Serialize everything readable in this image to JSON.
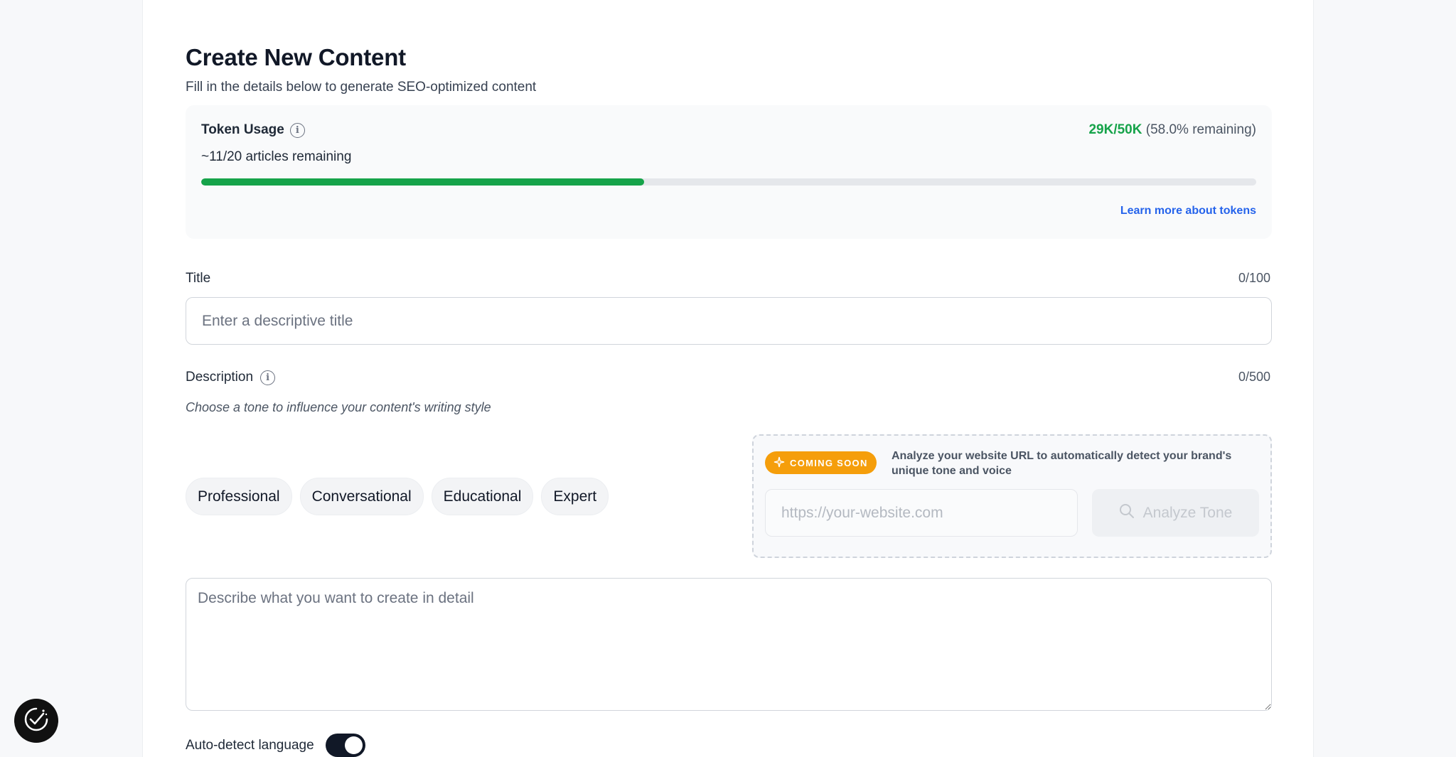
{
  "header": {
    "title": "Create New Content",
    "subtitle": "Fill in the details below to generate SEO-optimized content"
  },
  "token_usage": {
    "label": "Token Usage",
    "used": "29K/50K",
    "remaining": "(58.0% remaining)",
    "articles": "~11/20 articles remaining",
    "progress_fraction": 0.42,
    "learn_more": "Learn more about tokens"
  },
  "title_field": {
    "label": "Title",
    "counter": "0/100",
    "placeholder": "Enter a descriptive title"
  },
  "description_field": {
    "label": "Description",
    "counter": "0/500",
    "hint": "Choose a tone to influence your content's writing style",
    "placeholder": "Describe what you want to create in detail"
  },
  "tones": [
    "Professional",
    "Conversational",
    "Educational",
    "Expert"
  ],
  "analyzer": {
    "badge": "COMING SOON",
    "text": "Analyze your website URL to automatically detect your brand's unique tone and voice",
    "url_placeholder": "https://your-website.com",
    "button_label": "Analyze Tone"
  },
  "auto_detect": {
    "label": "Auto-detect language",
    "enabled": true
  },
  "colors": {
    "accent_green": "#16a34a",
    "link_blue": "#2563eb",
    "badge_orange": "#f59e0b"
  }
}
